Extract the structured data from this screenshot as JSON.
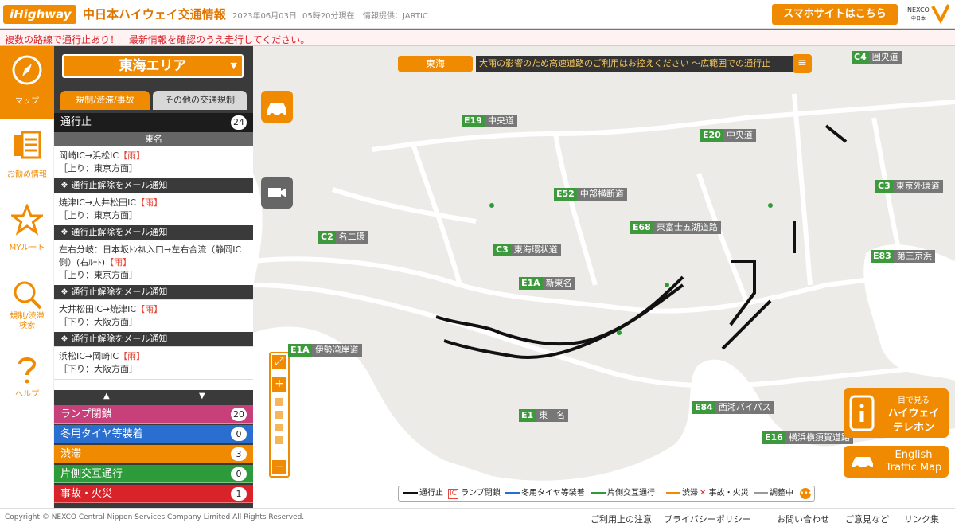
{
  "header": {
    "logo": "iHighway",
    "site_title": "中日本ハイウェイ交通情報",
    "date": "2023年06月03日",
    "time": "05時20分現在",
    "provider": "情報提供：JARTIC",
    "smartphone_button": "スマホサイトはこちら",
    "nexco_text": "中日本"
  },
  "alert": "複数の路線で通行止あり！　最新情報を確認のうえ走行してください。",
  "nav": [
    {
      "label": "マップ",
      "icon": "compass-icon"
    },
    {
      "label": "お勧め情報",
      "icon": "info-list-icon"
    },
    {
      "label": "MYルート",
      "icon": "star-icon"
    },
    {
      "label": "規制/渋滞\n検索",
      "icon": "search-icon"
    },
    {
      "label": "ヘルプ",
      "icon": "question-icon"
    }
  ],
  "panel": {
    "area": "東海エリア",
    "tabs": [
      "規制/渋滞/事故",
      "その他の交通規制"
    ],
    "closure_title": "通行止",
    "closure_count": "24",
    "direction_header": "東名",
    "mail_notify": "❖ 通行止解除をメール通知",
    "items": [
      {
        "route": "岡崎IC→浜松IC",
        "tag": "【雨】",
        "direction": "［上り：東京方面］"
      },
      {
        "route": "焼津IC→大井松田IC",
        "tag": "【雨】",
        "direction": "［上り：東京方面］"
      },
      {
        "route": "左右分岐：日本坂ﾄﾝﾈﾙ入口→左右合流（静岡IC側）(右ﾙｰﾄ)",
        "tag": "【雨】",
        "direction": "［上り：東京方面］"
      },
      {
        "route": "大井松田IC→焼津IC",
        "tag": "【雨】",
        "direction": "［下り：大阪方面］"
      },
      {
        "route": "浜松IC→岡崎IC",
        "tag": "【雨】",
        "direction": "［下り：大阪方面］"
      }
    ],
    "stats": [
      {
        "label": "ランプ閉鎖",
        "count": "20",
        "color": "#c8407a"
      },
      {
        "label": "冬用タイヤ等装着",
        "count": "0",
        "color": "#2a6fd0"
      },
      {
        "label": "渋滞",
        "count": "3",
        "color": "#f08a00"
      },
      {
        "label": "片側交互通行",
        "count": "0",
        "color": "#2e9b3a"
      },
      {
        "label": "事故・火災",
        "count": "1",
        "color": "#d8232a"
      }
    ]
  },
  "map": {
    "region": "東海",
    "ticker": "大雨の影響のため高速道路のご利用はお控えください ～広範囲での通行止",
    "roads": [
      {
        "code": "E19",
        "name": "中央道"
      },
      {
        "code": "E20",
        "name": "中央道"
      },
      {
        "code": "C3",
        "name": "東海環状道"
      },
      {
        "code": "E52",
        "name": "中部横断道"
      },
      {
        "code": "E1A",
        "name": "新東名"
      },
      {
        "code": "E1",
        "name": "東　名"
      },
      {
        "code": "C2",
        "name": "名二環"
      },
      {
        "code": "E1A",
        "name": "伊勢湾岸道"
      },
      {
        "code": "E68",
        "name": "東富士五湖道路"
      },
      {
        "code": "C3",
        "name": "東京外環道"
      },
      {
        "code": "E84",
        "name": "西湘バイパス"
      },
      {
        "code": "E16",
        "name": "横浜横須賀道路"
      },
      {
        "code": "C4",
        "name": "圏央道"
      },
      {
        "code": "E83",
        "name": "第三京浜"
      }
    ],
    "banner_tel": [
      "目で見る",
      "ハイウェイ",
      "テレホン"
    ],
    "banner_english": [
      "English",
      "Traffic Map"
    ],
    "legend": [
      {
        "label": "通行止",
        "color": "#111111"
      },
      {
        "label": "ランプ閉鎖",
        "ic": "IC"
      },
      {
        "label": "冬用タイヤ等装着",
        "color": "#2a6fd0"
      },
      {
        "label": "片側交互通行",
        "color": "#2e9b3a"
      },
      {
        "label": "渋滞",
        "color": "#f08a00"
      },
      {
        "label": "事故・火災",
        "mark": "✕"
      },
      {
        "label": "調整中",
        "color": "#999999"
      }
    ],
    "colors": {
      "highway": "#ffffff",
      "closed": "#111111",
      "accent": "#f08a00",
      "water": "#ffffff",
      "land": "#ecebe7"
    }
  },
  "footer": {
    "copyright": "Copyright © NEXCO Central Nippon Services Company Limited All Rights Reserved.",
    "links": [
      "ご利用上の注意",
      "プライバシーポリシー",
      "お問い合わせ",
      "ご意見など",
      "リンク集"
    ]
  }
}
